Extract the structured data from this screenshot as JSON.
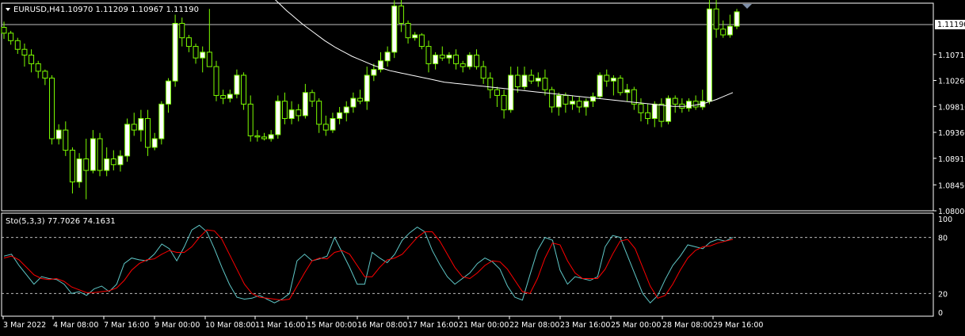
{
  "header": {
    "symbol": "EURUSD,H4",
    "ohlc": "1.10970 1.11209 1.10967 1.11190"
  },
  "indicator": {
    "label": "Sto(5,3,3) 77.7026 74.1631",
    "levels": [
      "100",
      "80",
      "20",
      "0"
    ]
  },
  "current_price_label": "1.11190",
  "colors": {
    "background": "#000000",
    "candle": "#7CFC00",
    "bull_fill": "#ffffff",
    "ma": "#ffffff",
    "main_line": "#5fc7c7",
    "signal_line": "#ff0000",
    "grid": "#ffffff"
  },
  "chart_data": [
    {
      "type": "candlestick",
      "title": "",
      "yticks": [
        "1.11190",
        "1.10710",
        "1.10260",
        "1.09810",
        "1.09360",
        "1.08910",
        "1.08450",
        "1.08000"
      ],
      "ylim": [
        1.08,
        1.116
      ],
      "xticks": [
        "3 Mar 2022",
        "4 Mar 08:00",
        "7 Mar 16:00",
        "9 Mar 00:00",
        "10 Mar 08:00",
        "11 Mar 16:00",
        "15 Mar 00:00",
        "16 Mar 08:00",
        "17 Mar 16:00",
        "21 Mar 00:00",
        "22 Mar 08:00",
        "23 Mar 16:00",
        "25 Mar 00:00",
        "28 Mar 08:00",
        "29 Mar 16:00"
      ],
      "candles_ohlc": [
        [
          1.1118,
          1.1128,
          1.1098,
          1.1108
        ],
        [
          1.1108,
          1.1112,
          1.1088,
          1.1095
        ],
        [
          1.1095,
          1.11,
          1.1072,
          1.108
        ],
        [
          1.108,
          1.109,
          1.105,
          1.107
        ],
        [
          1.107,
          1.108,
          1.104,
          1.1055
        ],
        [
          1.1055,
          1.106,
          1.103,
          1.1042
        ],
        [
          1.1042,
          1.1045,
          1.1018,
          1.103
        ],
        [
          1.103,
          1.1035,
          1.0915,
          1.0925
        ],
        [
          1.0925,
          1.095,
          1.0915,
          1.094
        ],
        [
          1.094,
          1.0955,
          1.0895,
          1.0905
        ],
        [
          1.0905,
          1.091,
          1.083,
          1.085
        ],
        [
          1.085,
          1.09,
          1.084,
          1.089
        ],
        [
          1.089,
          1.0925,
          1.082,
          1.087
        ],
        [
          1.087,
          1.094,
          1.0865,
          1.0925
        ],
        [
          1.0925,
          1.0935,
          1.086,
          1.087
        ],
        [
          1.087,
          1.091,
          1.086,
          1.089
        ],
        [
          1.089,
          1.0905,
          1.087,
          1.088
        ],
        [
          1.088,
          1.0905,
          1.0868,
          1.0895
        ],
        [
          1.0895,
          1.096,
          1.0885,
          1.095
        ],
        [
          1.095,
          1.097,
          1.093,
          1.094
        ],
        [
          1.094,
          1.0975,
          1.092,
          1.096
        ],
        [
          1.096,
          1.0975,
          1.0895,
          1.091
        ],
        [
          1.091,
          1.0935,
          1.0905,
          1.0925
        ],
        [
          1.0925,
          1.099,
          1.0915,
          1.0985
        ],
        [
          1.0985,
          1.103,
          1.097,
          1.1025
        ],
        [
          1.1025,
          1.114,
          1.1015,
          1.1125
        ],
        [
          1.1125,
          1.1135,
          1.1085,
          1.11
        ],
        [
          1.11,
          1.1105,
          1.1075,
          1.1085
        ],
        [
          1.1085,
          1.109,
          1.1055,
          1.1065
        ],
        [
          1.1065,
          1.1085,
          1.104,
          1.1075
        ],
        [
          1.1075,
          1.115,
          1.106,
          1.105
        ],
        [
          1.105,
          1.106,
          1.099,
          1.1
        ],
        [
          1.1,
          1.101,
          1.0985,
          1.0995
        ],
        [
          1.0995,
          1.101,
          1.0988,
          1.1002
        ],
        [
          1.1002,
          1.1045,
          1.0995,
          1.1035
        ],
        [
          1.1035,
          1.104,
          1.0975,
          1.0985
        ],
        [
          1.0985,
          1.1,
          1.092,
          1.093
        ],
        [
          1.093,
          1.094,
          1.092,
          1.0928
        ],
        [
          1.0928,
          1.0935,
          1.0922,
          1.0925
        ],
        [
          1.0925,
          1.094,
          1.092,
          1.0932
        ],
        [
          1.0932,
          1.1,
          1.0925,
          1.099
        ],
        [
          1.099,
          1.1005,
          1.095,
          1.096
        ],
        [
          1.096,
          1.099,
          1.095,
          1.0975
        ],
        [
          1.0975,
          1.0985,
          1.0955,
          1.0965
        ],
        [
          1.0965,
          1.102,
          1.096,
          1.1005
        ],
        [
          1.1005,
          1.101,
          1.098,
          1.099
        ],
        [
          1.099,
          1.0995,
          1.0935,
          1.095
        ],
        [
          1.095,
          1.0965,
          1.093,
          1.094
        ],
        [
          1.094,
          1.097,
          1.0935,
          1.096
        ],
        [
          1.096,
          1.098,
          1.095,
          1.097
        ],
        [
          1.097,
          1.099,
          1.0955,
          1.098
        ],
        [
          1.098,
          1.1005,
          1.097,
          1.0995
        ],
        [
          1.0995,
          1.101,
          1.0985,
          1.099
        ],
        [
          1.099,
          1.105,
          1.0975,
          1.1035
        ],
        [
          1.1035,
          1.1055,
          1.1025,
          1.1045
        ],
        [
          1.1045,
          1.1075,
          1.104,
          1.106
        ],
        [
          1.106,
          1.1085,
          1.105,
          1.1075
        ],
        [
          1.1075,
          1.1165,
          1.1065,
          1.1155
        ],
        [
          1.1155,
          1.117,
          1.111,
          1.1125
        ],
        [
          1.1125,
          1.113,
          1.109,
          1.11
        ],
        [
          1.11,
          1.111,
          1.1095,
          1.1105
        ],
        [
          1.1105,
          1.1108,
          1.108,
          1.1085
        ],
        [
          1.1085,
          1.1095,
          1.104,
          1.1055
        ],
        [
          1.1055,
          1.1075,
          1.1045,
          1.107
        ],
        [
          1.107,
          1.1085,
          1.106,
          1.1065
        ],
        [
          1.1065,
          1.1075,
          1.1055,
          1.107
        ],
        [
          1.107,
          1.108,
          1.1045,
          1.1055
        ],
        [
          1.1055,
          1.106,
          1.104,
          1.105
        ],
        [
          1.105,
          1.1075,
          1.1045,
          1.107
        ],
        [
          1.107,
          1.108,
          1.1045,
          1.105
        ],
        [
          1.105,
          1.106,
          1.102,
          1.103
        ],
        [
          1.103,
          1.104,
          1.0995,
          1.101
        ],
        [
          1.101,
          1.1015,
          1.098,
          1.1
        ],
        [
          1.1,
          1.101,
          1.096,
          1.0975
        ],
        [
          1.0975,
          1.105,
          1.097,
          1.1035
        ],
        [
          1.1035,
          1.105,
          1.1005,
          1.1015
        ],
        [
          1.1015,
          1.105,
          1.101,
          1.1035
        ],
        [
          1.1035,
          1.1045,
          1.102,
          1.1025
        ],
        [
          1.1025,
          1.104,
          1.1015,
          1.103
        ],
        [
          1.103,
          1.1045,
          1.1,
          1.101
        ],
        [
          1.101,
          1.1015,
          1.097,
          1.098
        ],
        [
          1.098,
          1.1005,
          1.0965,
          1.1
        ],
        [
          1.1,
          1.1005,
          1.097,
          1.0985
        ],
        [
          1.0985,
          1.1,
          1.0975,
          1.099
        ],
        [
          1.099,
          1.0998,
          1.097,
          1.098
        ],
        [
          1.098,
          1.0995,
          1.0965,
          1.099
        ],
        [
          1.099,
          1.1005,
          1.098,
          1.0998
        ],
        [
          1.0998,
          1.104,
          1.0995,
          1.1035
        ],
        [
          1.1035,
          1.1045,
          1.1015,
          1.1025
        ],
        [
          1.1025,
          1.1035,
          1.1,
          1.103
        ],
        [
          1.103,
          1.1035,
          1.1,
          1.1005
        ],
        [
          1.1005,
          1.102,
          1.099,
          1.101
        ],
        [
          1.101,
          1.1015,
          1.0975,
          1.0985
        ],
        [
          1.0985,
          1.0995,
          1.0955,
          1.097
        ],
        [
          1.097,
          1.0985,
          1.095,
          1.096
        ],
        [
          1.096,
          1.099,
          1.0945,
          1.0985
        ],
        [
          1.0985,
          1.0995,
          1.0945,
          1.0955
        ],
        [
          1.0955,
          1.1,
          1.095,
          1.0995
        ],
        [
          1.0995,
          1.1,
          1.097,
          1.0985
        ],
        [
          1.0985,
          1.0995,
          1.097,
          1.0978
        ],
        [
          1.0978,
          1.0995,
          1.0972,
          1.099
        ],
        [
          1.099,
          1.1,
          1.0975,
          1.098
        ],
        [
          1.098,
          1.101,
          1.0975,
          1.099
        ],
        [
          1.099,
          1.117,
          1.0985,
          1.115
        ],
        [
          1.115,
          1.118,
          1.11,
          1.1115
        ],
        [
          1.1115,
          1.113,
          1.11,
          1.1105
        ],
        [
          1.1105,
          1.114,
          1.11,
          1.112
        ],
        [
          1.112,
          1.115,
          1.1115,
          1.1145
        ]
      ],
      "ma": [
        1.1228,
        1.1219,
        1.121,
        1.1201,
        1.1192,
        1.1183,
        1.1174,
        1.1165,
        1.1156,
        1.1147,
        1.1139,
        1.1131,
        1.1123,
        1.1116,
        1.1109,
        1.1102,
        1.1095,
        1.1089,
        1.1083,
        1.1078,
        1.1073,
        1.1068,
        1.1064,
        1.106,
        1.1056,
        1.1052,
        1.1049,
        1.1046,
        1.1043,
        1.1041,
        1.1039,
        1.1037,
        1.1035,
        1.1033,
        1.1031,
        1.1029,
        1.1027,
        1.1025,
        1.1023,
        1.1022,
        1.1021,
        1.102,
        1.1019,
        1.1018,
        1.1017,
        1.1016,
        1.1015,
        1.1014,
        1.1013,
        1.1012,
        1.1011,
        1.101,
        1.1009,
        1.1008,
        1.1007,
        1.1006,
        1.1005,
        1.1004,
        1.1003,
        1.1002,
        1.1001,
        1.1,
        1.0999,
        1.0998,
        1.0997,
        1.0996,
        1.0995,
        1.0994,
        1.0993,
        1.0992,
        1.0991,
        1.099,
        1.0989,
        1.0988,
        1.0987,
        1.0986,
        1.0985,
        1.0984,
        1.0983,
        1.0982,
        1.0981,
        1.0981,
        1.0981,
        1.0982,
        1.0983,
        1.0985,
        1.0987,
        1.099,
        1.0993,
        1.0997,
        1.1001,
        1.1005
      ]
    },
    {
      "type": "line",
      "title": "Sto(5,3,3)",
      "ylim": [
        0,
        100
      ],
      "yticks": [
        "100",
        "80",
        "20",
        "0"
      ],
      "series": [
        {
          "name": "",
          "values": [
            60,
            62,
            50,
            40,
            30,
            38,
            36,
            35,
            30,
            20,
            22,
            18,
            25,
            28,
            22,
            30,
            52,
            58,
            56,
            55,
            62,
            73,
            68,
            55,
            70,
            88,
            93,
            86,
            68,
            48,
            30,
            16,
            14,
            15,
            18,
            14,
            10,
            14,
            20,
            55,
            62,
            55,
            57,
            60,
            80,
            64,
            48,
            30,
            30,
            64,
            58,
            53,
            62,
            77,
            85,
            91,
            86,
            66,
            51,
            38,
            30,
            36,
            42,
            52,
            58,
            54,
            46,
            28,
            16,
            13,
            40,
            66,
            80,
            77,
            45,
            30,
            38,
            36,
            34,
            38,
            70,
            82,
            80,
            60,
            40,
            20,
            10,
            18,
            35,
            50,
            60,
            72,
            70,
            68,
            75,
            78,
            76,
            80
          ]
        },
        {
          "name": "",
          "values": [
            58,
            60,
            56,
            48,
            40,
            36,
            35,
            36,
            33,
            27,
            24,
            21,
            21,
            22,
            23,
            26,
            34,
            45,
            52,
            56,
            57,
            62,
            66,
            64,
            64,
            70,
            80,
            88,
            87,
            78,
            62,
            46,
            30,
            20,
            16,
            15,
            14,
            13,
            14,
            28,
            42,
            55,
            58,
            57,
            64,
            66,
            62,
            50,
            38,
            38,
            48,
            56,
            58,
            62,
            71,
            80,
            86,
            86,
            76,
            62,
            48,
            38,
            36,
            42,
            50,
            55,
            54,
            46,
            34,
            22,
            20,
            36,
            58,
            74,
            72,
            55,
            42,
            36,
            36,
            36,
            46,
            62,
            76,
            78,
            68,
            48,
            28,
            15,
            18,
            30,
            45,
            58,
            66,
            70,
            71,
            74,
            76,
            78
          ]
        }
      ],
      "levels": [
        100,
        80,
        20,
        0
      ]
    }
  ]
}
